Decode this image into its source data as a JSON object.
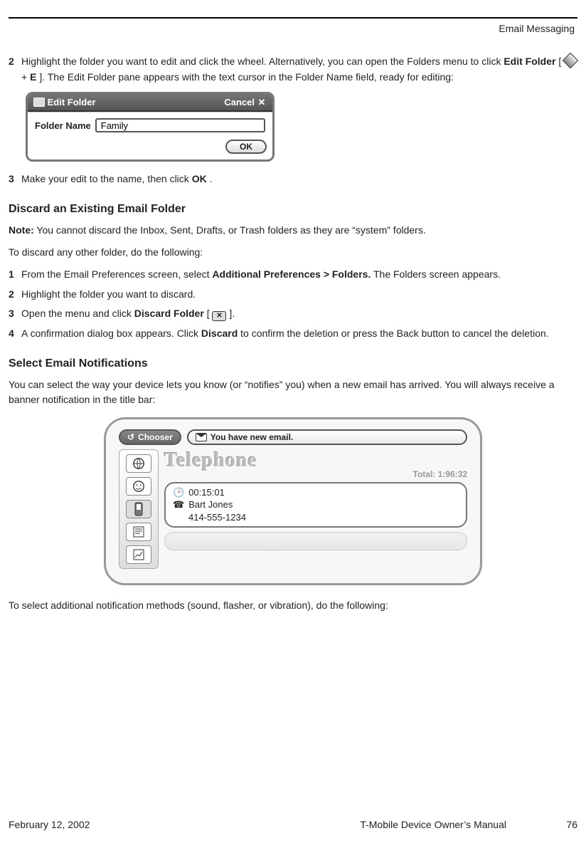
{
  "header": {
    "section": "Email Messaging"
  },
  "steps_a": {
    "s2_num": "2",
    "s2_pre": "Highlight the folder you want to edit and click the wheel. Alternatively, you can open the Folders menu to click ",
    "s2_bold": "Edit Folder",
    "s2_mid1": " [",
    "s2_plus": " + ",
    "s2_key": "E",
    "s2_mid2": "]. The Edit Folder pane appears with the text cursor in the Folder Name field, ready for editing:",
    "s3_num": "3",
    "s3_pre": "Make your edit to the name, then click ",
    "s3_bold": "OK",
    "s3_post": "."
  },
  "editfolder": {
    "title": "Edit Folder",
    "cancel": "Cancel",
    "label": "Folder Name",
    "value": "Family",
    "ok": "OK"
  },
  "headings": {
    "discard": "Discard an Existing Email Folder",
    "notif": "Select Email Notifications"
  },
  "note": {
    "label": "Note:",
    "text": " You cannot discard the Inbox, Sent, Drafts, or Trash folders as they are “system” folders."
  },
  "discard_intro": "To discard any other folder, do the following:",
  "steps_b": {
    "s1_num": "1",
    "s1_pre": "From the Email Preferences screen, select ",
    "s1_bold": "Additional Preferences > Folders.",
    "s1_post": " The Folders screen appears.",
    "s2_num": "2",
    "s2_text": "Highlight the folder you want to discard.",
    "s3_num": "3",
    "s3_pre": "Open the menu and click ",
    "s3_bold": "Discard Folder",
    "s3_mid": " [",
    "s3_end": "].",
    "s4_num": "4",
    "s4_pre": "A confirmation dialog box appears. Click ",
    "s4_bold": "Discard",
    "s4_post": " to confirm the deletion or press the Back button to cancel the deletion."
  },
  "notif_para": "You can select the way your device lets you know (or “notifies” you) when a new email has arrived. You will always receive a banner notification in the title bar:",
  "device": {
    "chooser": "Chooser",
    "banner": "You have new email.",
    "tele": "Telephone",
    "total_label": "Total: ",
    "total_value": "1:96:32",
    "call_time": "00:15:01",
    "call_name": "Bart Jones",
    "call_number": "414-555-1234"
  },
  "notif_outro": "To select additional notification methods (sound, flasher, or vibration), do the following:",
  "footer": {
    "date": "February 12, 2002",
    "manual": "T-Mobile Device Owner’s Manual",
    "page": "76"
  }
}
